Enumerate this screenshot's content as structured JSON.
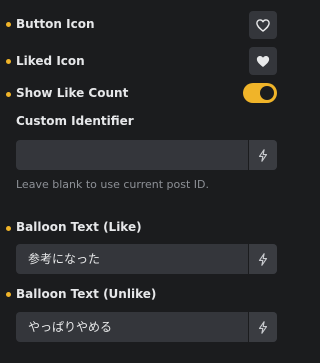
{
  "controls": {
    "button_icon": {
      "label": "Button Icon",
      "icon": "heart-outline-icon"
    },
    "liked_icon": {
      "label": "Liked Icon",
      "icon": "heart-filled-icon"
    },
    "show_like_count": {
      "label": "Show Like Count",
      "enabled": true
    },
    "custom_identifier": {
      "label": "Custom Identifier",
      "value": "",
      "help": "Leave blank to use current post ID.",
      "icon": "bolt-icon"
    },
    "balloon_like": {
      "label": "Balloon Text (Like)",
      "value": "参考になった",
      "icon": "bolt-icon"
    },
    "balloon_unlike": {
      "label": "Balloon Text (Unlike)",
      "value": "やっぱりやめる",
      "icon": "bolt-icon"
    }
  },
  "colors": {
    "accent": "#f0b429",
    "background": "#1b1c1e",
    "control": "#34363b",
    "muted_text": "#8d9096"
  }
}
